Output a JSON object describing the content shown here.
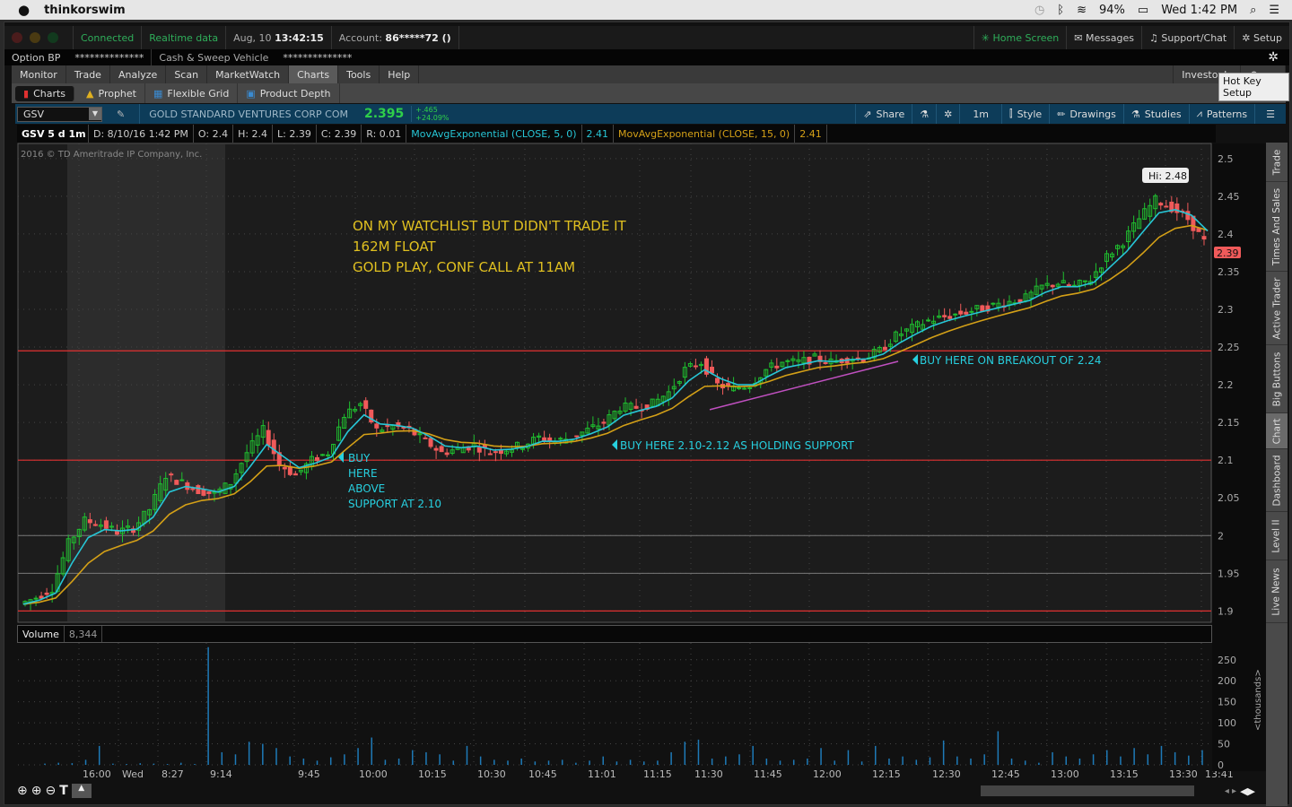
{
  "menubar": {
    "apple": "",
    "app": "thinkorswim",
    "battery": "94%",
    "clock": "Wed 1:42 PM"
  },
  "status": {
    "connected": "Connected",
    "realtime": "Realtime data",
    "date": "Aug, 10",
    "time": "13:42:15",
    "account_label": "Account:",
    "account": "86*****72 ()",
    "home": "Home Screen",
    "messages": "Messages",
    "support": "Support/Chat",
    "setup": "Setup"
  },
  "bp": {
    "option_bp": "Option BP",
    "option_val": "**************",
    "cash": "Cash & Sweep Vehicle",
    "cash_val": "**************"
  },
  "tabs": [
    "Monitor",
    "Trade",
    "Analyze",
    "Scan",
    "MarketWatch",
    "Charts",
    "Tools",
    "Help"
  ],
  "active_tab": "Charts",
  "investools": "Investools",
  "tooltip": "Hot Key Setup",
  "subtabs": [
    "Charts",
    "Prophet",
    "Flexible Grid",
    "Product Depth"
  ],
  "symbol": {
    "ticker": "GSV",
    "name": "GOLD STANDARD VENTURES CORP COM",
    "last": "2.395",
    "change": "+.465",
    "change_pct": "+24.09%"
  },
  "chart_toolbar": {
    "share": "Share",
    "interval": "1m",
    "style": "Style",
    "drawings": "Drawings",
    "studies": "Studies",
    "patterns": "Patterns"
  },
  "info": {
    "title": "GSV 5 d 1m",
    "date": "D: 8/10/16 1:42 PM",
    "open": "O: 2.4",
    "high": "H: 2.4",
    "low": "L: 2.39",
    "close": "C: 2.39",
    "range": "R: 0.01",
    "ema5_label": "MovAvgExponential (CLOSE, 5, 0)",
    "ema5_val": "2.41",
    "ema15_label": "MovAvgExponential (CLOSE, 15, 0)",
    "ema15_val": "2.41"
  },
  "copyright": "2016 © TD Ameritrade IP Company, Inc.",
  "annotations": {
    "note1": "ON MY WATCHLIST BUT DIDN'T TRADE IT",
    "note2": "162M FLOAT",
    "note3": "GOLD PLAY, CONF CALL AT 11AM",
    "buy1": [
      "BUY",
      "HERE",
      "ABOVE",
      "SUPPORT AT 2.10"
    ],
    "buy2": "BUY HERE 2.10-2.12 AS HOLDING SUPPORT",
    "buy3": "BUY HERE ON BREAKOUT OF 2.24",
    "hi": "Hi: 2.48",
    "last_tag": "2.39"
  },
  "colors": {
    "up": "#1fbf2f",
    "down": "#f05a5a",
    "ema5": "#27c6d6",
    "ema15": "#d4a017",
    "support": "#e03030",
    "trend": "#c050c0"
  },
  "chart_data": {
    "type": "candlestick",
    "yticks": [
      "2.5",
      "2.45",
      "2.4",
      "2.35",
      "2.3",
      "2.25",
      "2.2",
      "2.15",
      "2.1",
      "2.05",
      "2",
      "1.95",
      "1.9"
    ],
    "ylim": [
      1.885,
      2.52
    ],
    "xticks": [
      "16:00",
      "Wed",
      "8:27",
      "9:14",
      "9:45",
      "10:00",
      "10:15",
      "10:30",
      "10:45",
      "11:01",
      "11:15",
      "11:30",
      "11:45",
      "12:00",
      "12:15",
      "12:30",
      "12:45",
      "13:00",
      "13:15",
      "13:30",
      "13:41"
    ],
    "closes": [
      1.909,
      1.918,
      1.93,
      1.99,
      2.02,
      2.015,
      2.005,
      2.01,
      2.035,
      2.08,
      2.07,
      2.06,
      2.055,
      2.07,
      2.11,
      2.14,
      2.095,
      2.08,
      2.1,
      2.11,
      2.16,
      2.175,
      2.14,
      2.145,
      2.14,
      2.125,
      2.11,
      2.115,
      2.12,
      2.11,
      2.115,
      2.12,
      2.13,
      2.125,
      2.13,
      2.14,
      2.15,
      2.17,
      2.17,
      2.175,
      2.19,
      2.22,
      2.23,
      2.2,
      2.195,
      2.2,
      2.22,
      2.23,
      2.23,
      2.235,
      2.23,
      2.235,
      2.235,
      2.245,
      2.265,
      2.275,
      2.285,
      2.29,
      2.295,
      2.3,
      2.305,
      2.31,
      2.315,
      2.33,
      2.335,
      2.33,
      2.34,
      2.37,
      2.39,
      2.42,
      2.445,
      2.435,
      2.42,
      2.39
    ],
    "support_lines": [
      2.245,
      2.1,
      1.9
    ],
    "grey_lines": [
      2.0,
      1.95
    ],
    "trendline": [
      [
        2.167
      ],
      [
        2.231
      ]
    ],
    "volume": {
      "label": "Volume",
      "value": "8,344",
      "unit": "<thousands>",
      "yticks": [
        "250",
        "200",
        "150",
        "100",
        "50",
        "0"
      ],
      "ylim": [
        0,
        290
      ],
      "bars": [
        3,
        5,
        4,
        12,
        45,
        3,
        2,
        4,
        3,
        2,
        5,
        2,
        280,
        30,
        25,
        55,
        50,
        40,
        20,
        15,
        10,
        18,
        25,
        40,
        65,
        12,
        15,
        35,
        30,
        25,
        10,
        45,
        20,
        12,
        10,
        15,
        8,
        10,
        12,
        5,
        10,
        20,
        8,
        12,
        8,
        10,
        30,
        55,
        60,
        15,
        20,
        25,
        45,
        15,
        10,
        12,
        15,
        40,
        10,
        35,
        8,
        45,
        15,
        20,
        12,
        18,
        58,
        20,
        15,
        25,
        80,
        15,
        10,
        5,
        30,
        20,
        15,
        25,
        35,
        20,
        40,
        25,
        45,
        30,
        22,
        35
      ]
    }
  }
}
